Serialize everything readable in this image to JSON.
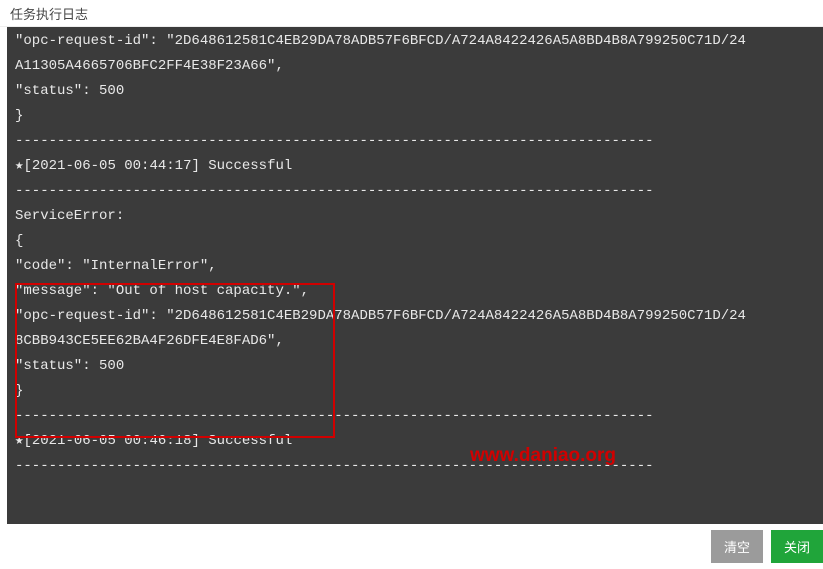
{
  "title": "任务执行日志",
  "log": {
    "l0": "    \"opc-request-id\": \"2D648612581C4EB29DA78ADB57F6BFCD/A724A8422426A5A8BD4B8A799250C71D/24",
    "l1": "A11305A4665706BFC2FF4E38F23A66\",",
    "l2": "    \"status\": 500",
    "l3": "}",
    "l4": "----------------------------------------------------------------------------",
    "l5": "[2021-06-05 00:44:17] Successful",
    "l6": "----------------------------------------------------------------------------",
    "l7": "",
    "l8": "ServiceError:",
    "l9": "{",
    "l10": "    \"code\": \"InternalError\",",
    "l11": "    \"message\": \"Out of host capacity.\",",
    "l12": "    \"opc-request-id\": \"2D648612581C4EB29DA78ADB57F6BFCD/A724A8422426A5A8BD4B8A799250C71D/24",
    "l13": "8CBB943CE5EE62BA4F26DFE4E8FAD6\",",
    "l14": "    \"status\": 500",
    "l15": "}",
    "l16": "----------------------------------------------------------------------------",
    "l17": "[2021-06-05 00:46:18] Successful",
    "l18": "----------------------------------------------------------------------------"
  },
  "watermark": "www.daniao.org",
  "buttons": {
    "clear": "清空",
    "close": "关闭"
  },
  "star": "★"
}
